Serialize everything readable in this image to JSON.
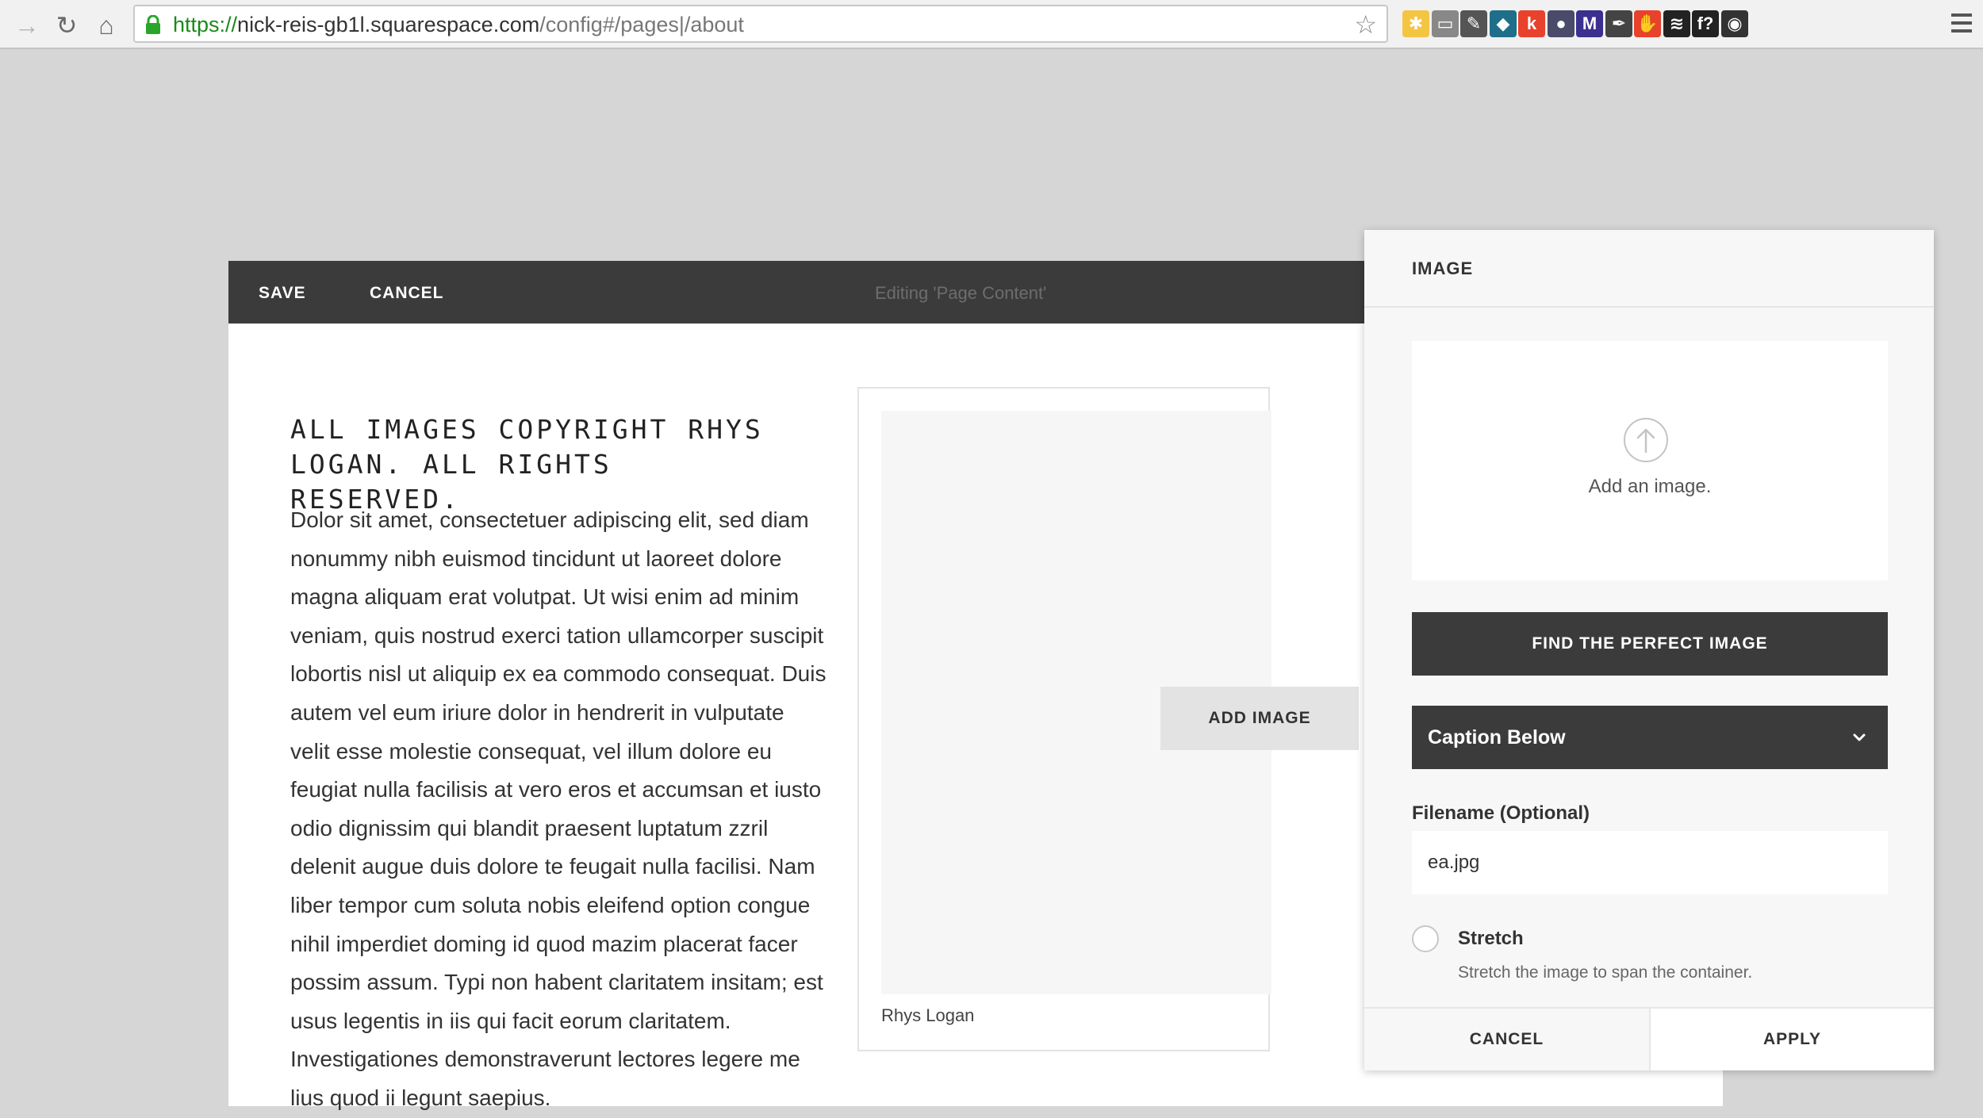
{
  "browser": {
    "url_scheme": "https://",
    "url_host": "nick-reis-gb1l.squarespace.com",
    "url_path": "/config#/pages|/about",
    "extensions": [
      {
        "name": "puzzle-extension-icon",
        "glyph": "✱",
        "color": "#f4c542"
      },
      {
        "name": "cast-icon",
        "glyph": "▭",
        "color": "#888888"
      },
      {
        "name": "evernote-icon",
        "glyph": "✎",
        "color": "#555555"
      },
      {
        "name": "gem-extension-icon",
        "glyph": "◆",
        "color": "#1f6f8b"
      },
      {
        "name": "k-extension-icon",
        "glyph": "k",
        "color": "#e8412c"
      },
      {
        "name": "mouse-extension-icon",
        "glyph": "●",
        "color": "#4a4a6a"
      },
      {
        "name": "m-extension-icon",
        "glyph": "M",
        "color": "#3b2f8f"
      },
      {
        "name": "eyedropper-icon",
        "glyph": "✒",
        "color": "#444444"
      },
      {
        "name": "adblock-icon",
        "glyph": "✋",
        "color": "#e8412c"
      },
      {
        "name": "layers-icon",
        "glyph": "≋",
        "color": "#222222"
      },
      {
        "name": "whatfont-icon",
        "glyph": "f?",
        "color": "#222222"
      },
      {
        "name": "color-wheel-icon",
        "glyph": "◉",
        "color": "#333333"
      }
    ]
  },
  "toolbar": {
    "save_label": "SAVE",
    "cancel_label": "CANCEL",
    "editing_label": "Editing 'Page Content'"
  },
  "page": {
    "heading": "ALL IMAGES COPYRIGHT RHYS LOGAN. ALL RIGHTS RESERVED.",
    "body": "Dolor sit amet, consectetuer adipiscing elit, sed diam nonummy nibh euismod tincidunt ut laoreet dolore magna aliquam erat volutpat. Ut wisi enim ad minim veniam, quis nostrud exerci tation ullamcorper suscipit lobortis nisl ut aliquip ex ea commodo consequat. Duis autem vel eum iriure dolor in hendrerit in vulputate velit esse molestie consequat, vel illum dolore eu feugiat nulla facilisis at vero eros et accumsan et iusto odio dignissim qui blandit praesent luptatum zzril delenit augue duis dolore te feugait nulla facilisi. Nam liber tempor cum soluta nobis eleifend option congue nihil imperdiet doming id quod mazim placerat facer possim assum. Typi non habent claritatem insitam; est usus legentis in iis qui facit eorum claritatem. Investigationes demonstraverunt lectores legere me lius quod ii legunt saepius.",
    "add_image_label": "ADD IMAGE",
    "image_caption": "Rhys Logan"
  },
  "panel": {
    "title": "IMAGE",
    "upload_text": "Add an image.",
    "find_button_label": "FIND THE PERFECT IMAGE",
    "caption_option": "Caption Below",
    "filename_label": "Filename (Optional)",
    "filename_value": "ea.jpg",
    "stretch_label": "Stretch",
    "stretch_description": "Stretch the image to span the container.",
    "stretch_checked": false,
    "cancel_label": "CANCEL",
    "apply_label": "APPLY"
  }
}
